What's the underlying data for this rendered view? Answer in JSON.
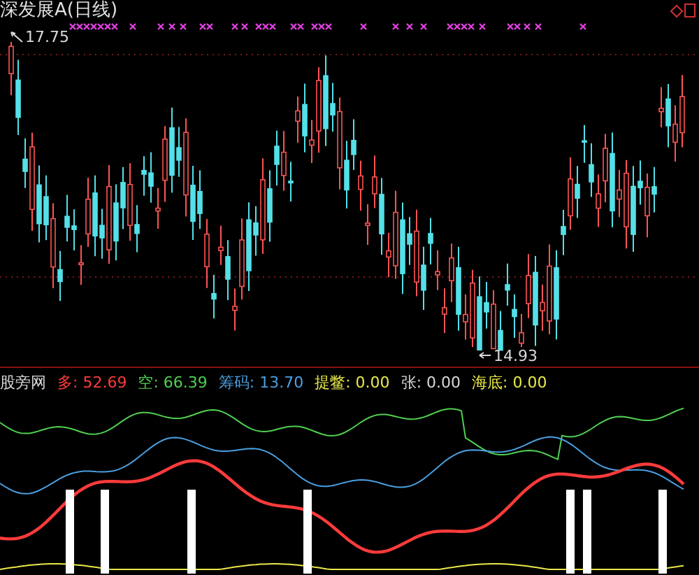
{
  "chart_title": "深发展A(日线)",
  "price_chart": {
    "high_label": "17.75",
    "low_label": "14.93"
  },
  "indicator": {
    "name": "股旁网",
    "legend": [
      {
        "label": "多:",
        "value": "52.69",
        "color": "#ff3b3b"
      },
      {
        "label": "空:",
        "value": "66.39",
        "color": "#4fd04f"
      },
      {
        "label": "筹码:",
        "value": "13.70",
        "color": "#4a9fe0"
      },
      {
        "label": "提鳖:",
        "value": "0.00",
        "color": "#e8e84a"
      },
      {
        "label": "张:",
        "value": "0.00",
        "color": "#d8d8d8"
      },
      {
        "label": "海底:",
        "value": "0.00",
        "color": "#e8e84a"
      }
    ]
  }
}
